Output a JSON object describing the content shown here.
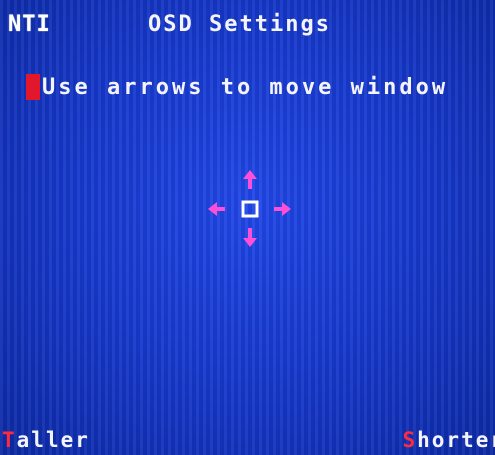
{
  "header": {
    "brand": "NTI",
    "title": "OSD Settings"
  },
  "main": {
    "instruction": "Use arrows to move window"
  },
  "softkeys": {
    "left": {
      "hotkey": "T",
      "rest": "aller"
    },
    "right": {
      "hotkey": "S",
      "rest": "horter"
    }
  },
  "colors": {
    "background": "#1537c9",
    "text": "#f4f4ff",
    "cursor": "#e3172b",
    "hotkey": "#ff2a3f",
    "arrows": "#ff4fd8",
    "center_box": "#ffffff"
  },
  "icons": [
    "up-arrow-icon",
    "down-arrow-icon",
    "left-arrow-icon",
    "right-arrow-icon",
    "window-position-box-icon"
  ]
}
